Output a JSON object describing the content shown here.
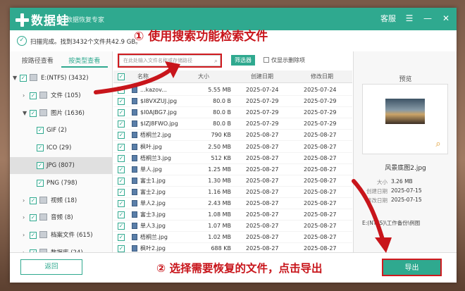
{
  "app": {
    "name": "数据蛙",
    "subtitle": "数据恢复专家",
    "service_label": "客服"
  },
  "status": {
    "message": "扫描完成。找到3432个文件共42.9 GB。"
  },
  "annotations": {
    "step1": "① 使用搜索功能检索文件",
    "step2": "② 选择需要恢复的文件，点击导出"
  },
  "left": {
    "tabs": [
      {
        "label": "按路径查看",
        "active": false
      },
      {
        "label": "按类型查看",
        "active": true
      }
    ],
    "tree": [
      {
        "label": "E:(NTFS) (3432)",
        "level": 0,
        "expand": "▼",
        "icon": "drive-icon",
        "selected": false
      },
      {
        "label": "文件 (105)",
        "level": 1,
        "expand": "›",
        "icon": "file-icon",
        "selected": false
      },
      {
        "label": "图片 (1636)",
        "level": 1,
        "expand": "▼",
        "icon": "image-icon",
        "selected": false
      },
      {
        "label": "GIF (2)",
        "level": 2,
        "expand": "",
        "icon": "",
        "selected": false
      },
      {
        "label": "ICO (29)",
        "level": 2,
        "expand": "",
        "icon": "",
        "selected": false
      },
      {
        "label": "JPG (807)",
        "level": 2,
        "expand": "",
        "icon": "",
        "selected": true
      },
      {
        "label": "PNG (798)",
        "level": 2,
        "expand": "",
        "icon": "",
        "selected": false
      },
      {
        "label": "视频 (18)",
        "level": 1,
        "expand": "›",
        "icon": "video-icon",
        "selected": false
      },
      {
        "label": "音频 (8)",
        "level": 1,
        "expand": "›",
        "icon": "audio-icon",
        "selected": false
      },
      {
        "label": "档案文件 (615)",
        "level": 1,
        "expand": "›",
        "icon": "archive-icon",
        "selected": false
      },
      {
        "label": "数据库 (24)",
        "level": 1,
        "expand": "›",
        "icon": "database-icon",
        "selected": false
      }
    ]
  },
  "toolbar": {
    "search_placeholder": "在此处输入文件名称或存储路径",
    "filter_label": "筛选器",
    "deleted_only_label": "仅显示删除项"
  },
  "table": {
    "headers": {
      "name": "名称",
      "size": "大小",
      "created": "创建日期",
      "modified": "修改日期"
    },
    "rows": [
      {
        "name": "...kazov...",
        "size": "5.55 MB",
        "created": "2025-07-24",
        "modified": "2025-07-24"
      },
      {
        "name": "$I8VXZUJ.jpg",
        "size": "80.0 B",
        "created": "2025-07-29",
        "modified": "2025-07-29"
      },
      {
        "name": "$I0AJBG7.jpg",
        "size": "80.0 B",
        "created": "2025-07-29",
        "modified": "2025-07-29"
      },
      {
        "name": "$IZJ8FWO.jpg",
        "size": "80.0 B",
        "created": "2025-07-29",
        "modified": "2025-07-29"
      },
      {
        "name": "梧桐兰2.jpg",
        "size": "790 KB",
        "created": "2025-08-27",
        "modified": "2025-08-27"
      },
      {
        "name": "枫叶.jpg",
        "size": "2.50 MB",
        "created": "2025-08-27",
        "modified": "2025-08-27"
      },
      {
        "name": "梧桐兰3.jpg",
        "size": "512 KB",
        "created": "2025-08-27",
        "modified": "2025-08-27"
      },
      {
        "name": "单人.jpg",
        "size": "1.25 MB",
        "created": "2025-08-27",
        "modified": "2025-08-27"
      },
      {
        "name": "富士1.jpg",
        "size": "1.30 MB",
        "created": "2025-08-27",
        "modified": "2025-08-27"
      },
      {
        "name": "富士2.jpg",
        "size": "1.16 MB",
        "created": "2025-08-27",
        "modified": "2025-08-27"
      },
      {
        "name": "单人2.jpg",
        "size": "2.43 MB",
        "created": "2025-08-27",
        "modified": "2025-08-27"
      },
      {
        "name": "富士3.jpg",
        "size": "1.08 MB",
        "created": "2025-08-27",
        "modified": "2025-08-27"
      },
      {
        "name": "单人3.jpg",
        "size": "1.07 MB",
        "created": "2025-08-27",
        "modified": "2025-08-27"
      },
      {
        "name": "梧桐兰.jpg",
        "size": "1.02 MB",
        "created": "2025-08-27",
        "modified": "2025-08-27"
      },
      {
        "name": "枫叶2.jpg",
        "size": "688 KB",
        "created": "2025-08-27",
        "modified": "2025-08-27"
      }
    ]
  },
  "preview": {
    "title": "预览",
    "file_name": "风景底图2.jpg",
    "info": [
      {
        "key": "大小",
        "value": "3.26 MB"
      },
      {
        "key": "创建日期",
        "value": "2025-07-15"
      },
      {
        "key": "修改日期",
        "value": "2025-07-15"
      }
    ],
    "path": "E:(NTFS)\\工作备份\\例图"
  },
  "footer": {
    "back_label": "返回",
    "export_label": "导出"
  },
  "colors": {
    "accent": "#2fa98f",
    "annotation_red": "#c8151b"
  }
}
